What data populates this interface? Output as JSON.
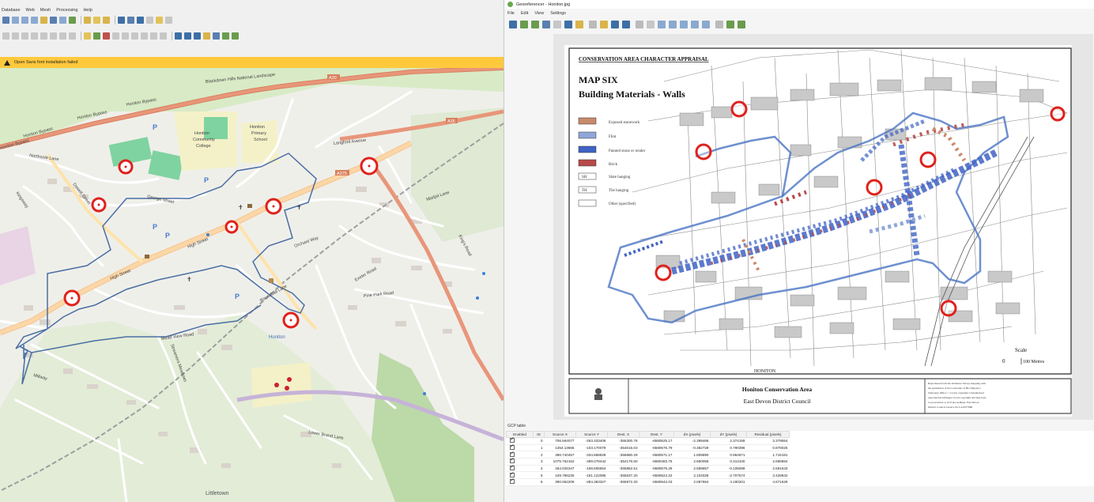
{
  "qgis": {
    "menu": [
      "Database",
      "Web",
      "Mesh",
      "Processing",
      "Help"
    ],
    "message": "Open Sans font installation failed"
  },
  "map": {
    "roads": {
      "honiton_bypass_1": "Honiton Bypass",
      "honiton_bypass_2": "Honiton Bypass",
      "honiton_bypass_3": "Honiton Bypass",
      "honiton_bypass_4": "Honiton Bypass",
      "a30": "A30",
      "a35": "A35",
      "a375": "A375",
      "blackdown": "Blackdown Hills National Landscape",
      "high_street_1": "High Street",
      "high_street_2": "High Street",
      "george_street": "George Street",
      "dowell_street": "Dowell Street",
      "northcote_lane": "Northcote Lane",
      "kingsway": "Kingsway",
      "langford_avenue": "Langford Avenue",
      "marlpit_lane": "Marlpit Lane",
      "orchard_way": "Orchard Way",
      "pine_park_road": "Pine Park Road",
      "kings_road": "King's Road",
      "streamers_meadows": "Streamers Meadows",
      "mead_view_road": "Mead View Road",
      "millway": "Millway",
      "lower_brand_lane": "Lower Brand Lane",
      "littletown": "Littletown",
      "roundball_lane": "Roundball Lane",
      "exeter_road": "Exeter Road",
      "station": "Honiton"
    },
    "places": {
      "college_1": "Honiton",
      "college_2": "Community",
      "college_3": "College",
      "primary_1": "Honiton",
      "primary_2": "Primary",
      "primary_3": "School"
    }
  },
  "georef": {
    "title": "Georeferencer - Honiton.jpg",
    "menu": [
      "File",
      "Edit",
      "View",
      "Settings"
    ]
  },
  "scan": {
    "header": "CONSERVATION AREA CHARACTER APPRAISAL",
    "title_1": "MAP SIX",
    "title_2": "Building Materials - Walls",
    "legend": [
      {
        "label": "Exposed stonework",
        "color": "#c98a6b",
        "code": ""
      },
      {
        "label": "Flint",
        "color": "#8fa6d9",
        "code": ""
      },
      {
        "label": "Painted stone or render",
        "color": "#3f63c4",
        "code": ""
      },
      {
        "label": "Brick",
        "color": "#b84a4a",
        "code": ""
      },
      {
        "label": "Slate hanging",
        "color": "#ffffff",
        "code": "SH"
      },
      {
        "label": "Tile hanging",
        "color": "#ffffff",
        "code": "TH"
      },
      {
        "label": "Other (specified)",
        "color": "#ffffff",
        "code": ""
      }
    ],
    "scale_label": "Scale",
    "scale_zero": "0",
    "scale_text": "100 Metres",
    "place_label": "HONITON",
    "footer_title": "Honiton Conservation Area",
    "footer_sub": "East Devon District Council",
    "copyright": [
      "Reproduced from the Ordnance Survey mapping with",
      "the permission of the Controller of Her Majesty's",
      "Stationery Office © Crown copyright. Unauthorised",
      "reproduction infringes Crown copyright and may lead",
      "to prosecution or civil proceedings. East Devon",
      "District Council Licence No LA 0077880"
    ]
  },
  "gcp": {
    "label": "GCP table",
    "columns": [
      "Enabled",
      "ID",
      "Source X",
      "Source Y",
      "Dest. X",
      "Dest. Y",
      "dX (pixels)",
      "dY (pixels)",
      "Residual (pixels)"
    ],
    "rows": [
      {
        "id": "0",
        "sx": "706.564077",
        "sy": "-263.333408",
        "dx": "-355300.76",
        "dy": "-6580525.17",
        "ex": "-2.399466",
        "ey": "2.374159",
        "res": "3.379554"
      },
      {
        "id": "1",
        "sx": "1354.13665",
        "sy": "-103.170079",
        "dx": "-354016.03",
        "dy": "-6580576.79",
        "ex": "-0.382729",
        "ey": "0.790396",
        "res": "0.878025"
      },
      {
        "id": "2",
        "sx": "396.740457",
        "sy": "-334.858928",
        "dx": "-356880.29",
        "dy": "-6580571.17",
        "ex": "1.808890",
        "ey": "0.964671",
        "res": "1.715191"
      },
      {
        "id": "3",
        "sx": "1075.762162",
        "sy": "-499.078442",
        "dx": "-354176.50",
        "dy": "-6580483.75",
        "ex": "2.650055",
        "ey": "0.313100",
        "res": "2.668864"
      },
      {
        "id": "4",
        "sx": "264.025347",
        "sy": "-168.605654",
        "dx": "-355862.51",
        "dy": "-6580675.26",
        "ex": "2.589657",
        "ey": "-0.105599",
        "res": "2.591643"
      },
      {
        "id": "5",
        "sx": "449.786230",
        "sy": "-181.122095",
        "dx": "-355537.20",
        "dy": "-6580624.22",
        "ex": "2.104028",
        "ey": "-2.707574",
        "res": "3.428842"
      },
      {
        "id": "6",
        "sx": "390.062209",
        "sy": "-284.383327",
        "dx": "-355972.20",
        "dy": "-6580542.03",
        "ex": "2.087664",
        "ey": "4.180201",
        "res": "4.671526"
      }
    ]
  }
}
